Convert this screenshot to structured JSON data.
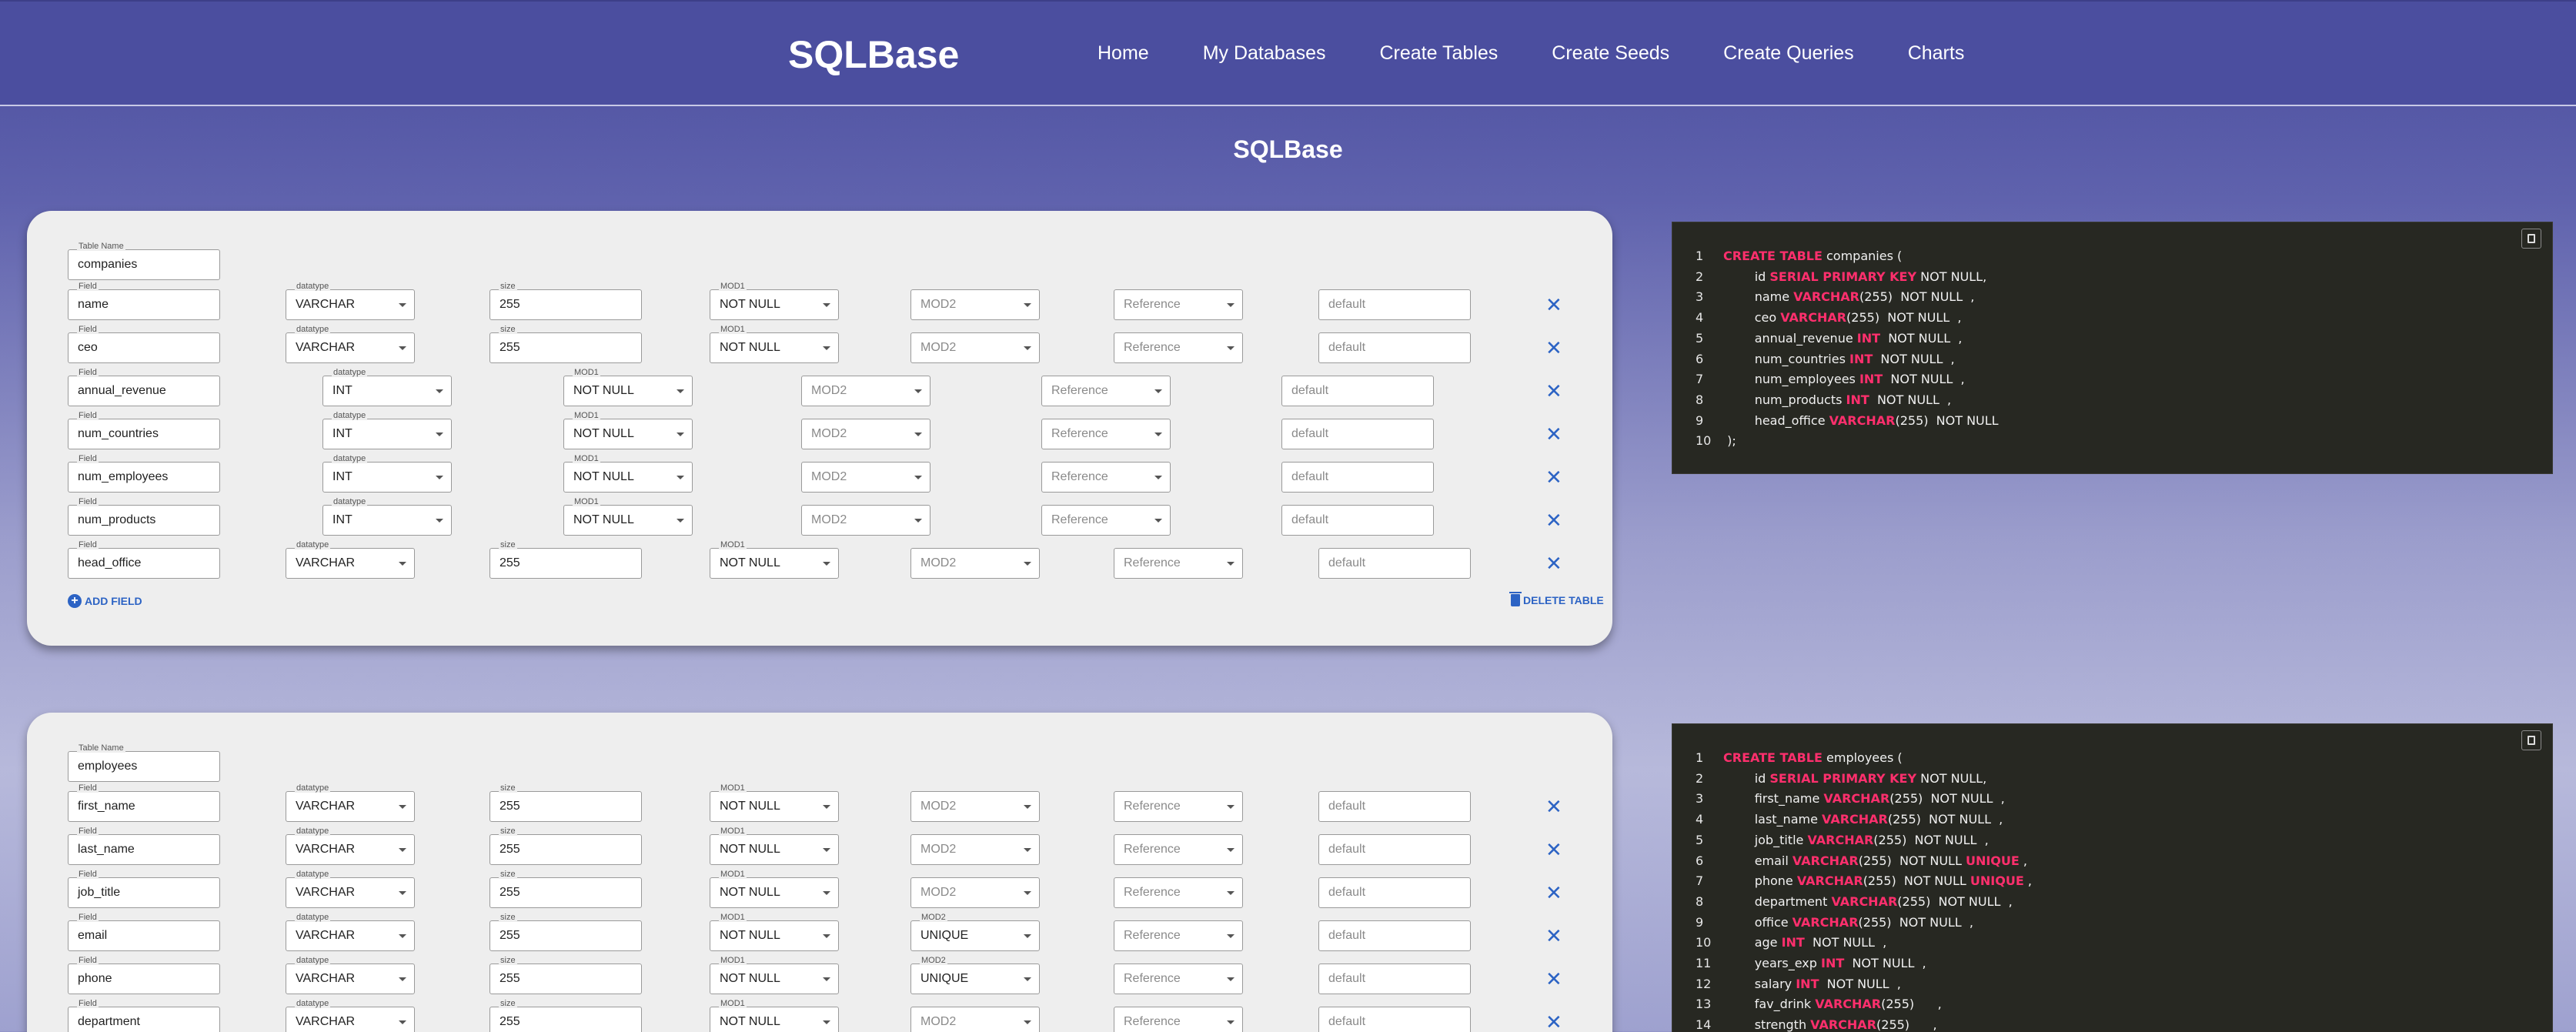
{
  "nav": {
    "brand": "SQLBase",
    "links": [
      "Home",
      "My Databases",
      "Create Tables",
      "Create Seeds",
      "Create Queries",
      "Charts"
    ]
  },
  "page_title": "SQLBase",
  "labels": {
    "table_name": "Table Name",
    "field": "Field",
    "datatype": "datatype",
    "size": "size",
    "mod1": "MOD1",
    "mod2": "MOD2"
  },
  "placeholders": {
    "mod2": "MOD2",
    "reference": "Reference",
    "default": "default"
  },
  "actions": {
    "add_field": "ADD FIELD",
    "delete_table": "DELETE TABLE",
    "remove": "✕"
  },
  "tables": [
    {
      "name": "companies",
      "fields": [
        {
          "field": "name",
          "datatype": "VARCHAR",
          "size": "255",
          "mod1": "NOT NULL",
          "mod2": ""
        },
        {
          "field": "ceo",
          "datatype": "VARCHAR",
          "size": "255",
          "mod1": "NOT NULL",
          "mod2": ""
        },
        {
          "field": "annual_revenue",
          "datatype": "INT",
          "size": null,
          "mod1": "NOT NULL",
          "mod2": ""
        },
        {
          "field": "num_countries",
          "datatype": "INT",
          "size": null,
          "mod1": "NOT NULL",
          "mod2": ""
        },
        {
          "field": "num_employees",
          "datatype": "INT",
          "size": null,
          "mod1": "NOT NULL",
          "mod2": ""
        },
        {
          "field": "num_products",
          "datatype": "INT",
          "size": null,
          "mod1": "NOT NULL",
          "mod2": ""
        },
        {
          "field": "head_office",
          "datatype": "VARCHAR",
          "size": "255",
          "mod1": "NOT NULL",
          "mod2": ""
        }
      ],
      "sql": [
        [
          [
            "kw",
            "CREATE TABLE"
          ],
          [
            "t",
            " companies ("
          ]
        ],
        [
          [
            "t",
            "        id "
          ],
          [
            "kw",
            "SERIAL PRIMARY KEY"
          ],
          [
            "t",
            " NOT NULL,"
          ]
        ],
        [
          [
            "t",
            "        name "
          ],
          [
            "kw",
            "VARCHAR"
          ],
          [
            "t",
            "(255)  NOT NULL  ,"
          ]
        ],
        [
          [
            "t",
            "        ceo "
          ],
          [
            "kw",
            "VARCHAR"
          ],
          [
            "t",
            "(255)  NOT NULL  ,"
          ]
        ],
        [
          [
            "t",
            "        annual_revenue "
          ],
          [
            "kw",
            "INT"
          ],
          [
            "t",
            "  NOT NULL  ,"
          ]
        ],
        [
          [
            "t",
            "        num_countries "
          ],
          [
            "kw",
            "INT"
          ],
          [
            "t",
            "  NOT NULL  ,"
          ]
        ],
        [
          [
            "t",
            "        num_employees "
          ],
          [
            "kw",
            "INT"
          ],
          [
            "t",
            "  NOT NULL  ,"
          ]
        ],
        [
          [
            "t",
            "        num_products "
          ],
          [
            "kw",
            "INT"
          ],
          [
            "t",
            "  NOT NULL  ,"
          ]
        ],
        [
          [
            "t",
            "        head_office "
          ],
          [
            "kw",
            "VARCHAR"
          ],
          [
            "t",
            "(255)  NOT NULL"
          ]
        ],
        [
          [
            "t",
            " );"
          ]
        ]
      ]
    },
    {
      "name": "employees",
      "fields": [
        {
          "field": "first_name",
          "datatype": "VARCHAR",
          "size": "255",
          "mod1": "NOT NULL",
          "mod2": ""
        },
        {
          "field": "last_name",
          "datatype": "VARCHAR",
          "size": "255",
          "mod1": "NOT NULL",
          "mod2": ""
        },
        {
          "field": "job_title",
          "datatype": "VARCHAR",
          "size": "255",
          "mod1": "NOT NULL",
          "mod2": ""
        },
        {
          "field": "email",
          "datatype": "VARCHAR",
          "size": "255",
          "mod1": "NOT NULL",
          "mod2": "UNIQUE"
        },
        {
          "field": "phone",
          "datatype": "VARCHAR",
          "size": "255",
          "mod1": "NOT NULL",
          "mod2": "UNIQUE"
        },
        {
          "field": "department",
          "datatype": "VARCHAR",
          "size": "255",
          "mod1": "NOT NULL",
          "mod2": ""
        }
      ],
      "sql": [
        [
          [
            "kw",
            "CREATE TABLE"
          ],
          [
            "t",
            " employees ("
          ]
        ],
        [
          [
            "t",
            "        id "
          ],
          [
            "kw",
            "SERIAL PRIMARY KEY"
          ],
          [
            "t",
            " NOT NULL,"
          ]
        ],
        [
          [
            "t",
            "        first_name "
          ],
          [
            "kw",
            "VARCHAR"
          ],
          [
            "t",
            "(255)  NOT NULL  ,"
          ]
        ],
        [
          [
            "t",
            "        last_name "
          ],
          [
            "kw",
            "VARCHAR"
          ],
          [
            "t",
            "(255)  NOT NULL  ,"
          ]
        ],
        [
          [
            "t",
            "        job_title "
          ],
          [
            "kw",
            "VARCHAR"
          ],
          [
            "t",
            "(255)  NOT NULL  ,"
          ]
        ],
        [
          [
            "t",
            "        email "
          ],
          [
            "kw",
            "VARCHAR"
          ],
          [
            "t",
            "(255)  NOT NULL "
          ],
          [
            "kw",
            "UNIQUE"
          ],
          [
            "t",
            " ,"
          ]
        ],
        [
          [
            "t",
            "        phone "
          ],
          [
            "kw",
            "VARCHAR"
          ],
          [
            "t",
            "(255)  NOT NULL "
          ],
          [
            "kw",
            "UNIQUE"
          ],
          [
            "t",
            " ,"
          ]
        ],
        [
          [
            "t",
            "        department "
          ],
          [
            "kw",
            "VARCHAR"
          ],
          [
            "t",
            "(255)  NOT NULL  ,"
          ]
        ],
        [
          [
            "t",
            "        office "
          ],
          [
            "kw",
            "VARCHAR"
          ],
          [
            "t",
            "(255)  NOT NULL  ,"
          ]
        ],
        [
          [
            "t",
            "        age "
          ],
          [
            "kw",
            "INT"
          ],
          [
            "t",
            "  NOT NULL  ,"
          ]
        ],
        [
          [
            "t",
            "        years_exp "
          ],
          [
            "kw",
            "INT"
          ],
          [
            "t",
            "  NOT NULL  ,"
          ]
        ],
        [
          [
            "t",
            "        salary "
          ],
          [
            "kw",
            "INT"
          ],
          [
            "t",
            "  NOT NULL  ,"
          ]
        ],
        [
          [
            "t",
            "        fav_drink "
          ],
          [
            "kw",
            "VARCHAR"
          ],
          [
            "t",
            "(255)      ,"
          ]
        ],
        [
          [
            "t",
            "        strength "
          ],
          [
            "kw",
            "VARCHAR"
          ],
          [
            "t",
            "(255)      ,"
          ]
        ]
      ]
    }
  ]
}
